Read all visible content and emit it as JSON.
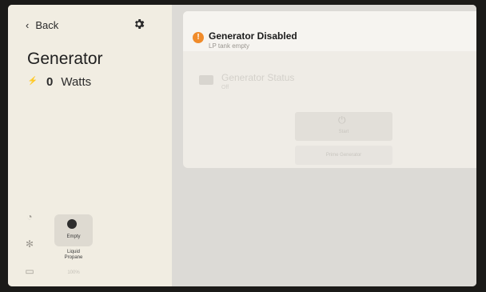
{
  "sidebar": {
    "back_label": "Back",
    "title": "Generator",
    "watts_value": "0",
    "watts_unit": "Watts",
    "tank": {
      "status": "Empty",
      "label": "Liquid Propane",
      "sublabel": "100%"
    }
  },
  "alert": {
    "title": "Generator Disabled",
    "subtitle": "LP tank empty"
  },
  "status": {
    "title": "Generator Status",
    "value": "Off"
  },
  "controls": {
    "start_label": "Start",
    "prime_label": "Prime Generator"
  },
  "icons": {
    "back": "chevron-left-icon",
    "settings": "gear-icon",
    "power": "power-icon",
    "warning": "exclamation-icon"
  },
  "colors": {
    "warning": "#f08b2a"
  }
}
